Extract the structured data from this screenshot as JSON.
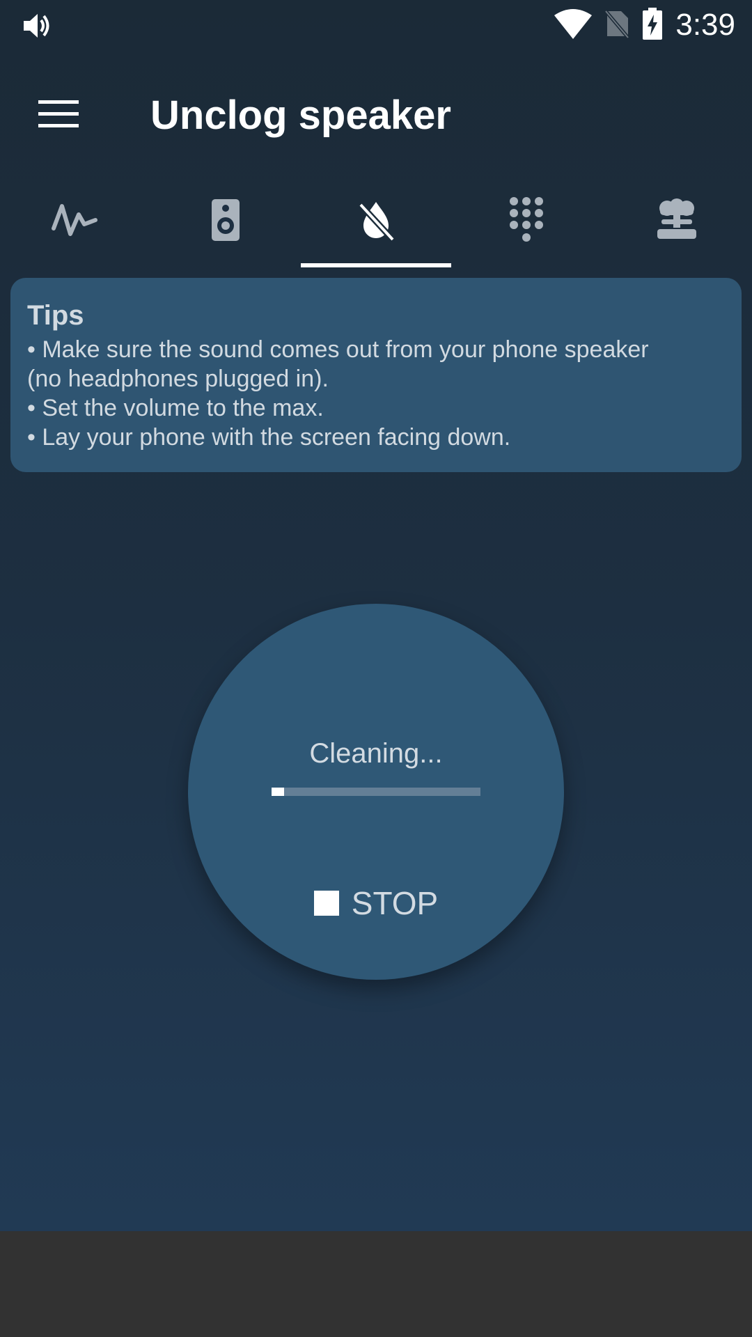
{
  "status_bar": {
    "time": "3:39",
    "icons": [
      "volume-icon",
      "wifi-icon",
      "no-sim-icon",
      "battery-charging-icon"
    ]
  },
  "app_bar": {
    "title": "Unclog speaker",
    "menu_icon": "menu-icon"
  },
  "tabs": {
    "items": [
      {
        "icon": "waveform-icon",
        "selected": false
      },
      {
        "icon": "speaker-icon",
        "selected": false
      },
      {
        "icon": "water-drop-off-icon",
        "selected": true
      },
      {
        "icon": "dialpad-icon",
        "selected": false
      },
      {
        "icon": "explosion-icon",
        "selected": false
      }
    ]
  },
  "tips": {
    "title": "Tips",
    "lines": [
      "• Make sure the sound comes out from your phone speaker",
      "(no headphones plugged in).",
      "• Set the volume to the max.",
      "• Lay your phone with the screen facing down."
    ]
  },
  "cleaner": {
    "status": "Cleaning...",
    "progress": 0.06,
    "stop_label": "STOP",
    "stop_icon": "stop-icon"
  },
  "colors": {
    "background_top": "#1b2a37",
    "background_bottom": "#213a54",
    "card": "#2f5572",
    "circle": "#2f5876",
    "progress_track": "#647f96",
    "navbar": "#323232"
  }
}
